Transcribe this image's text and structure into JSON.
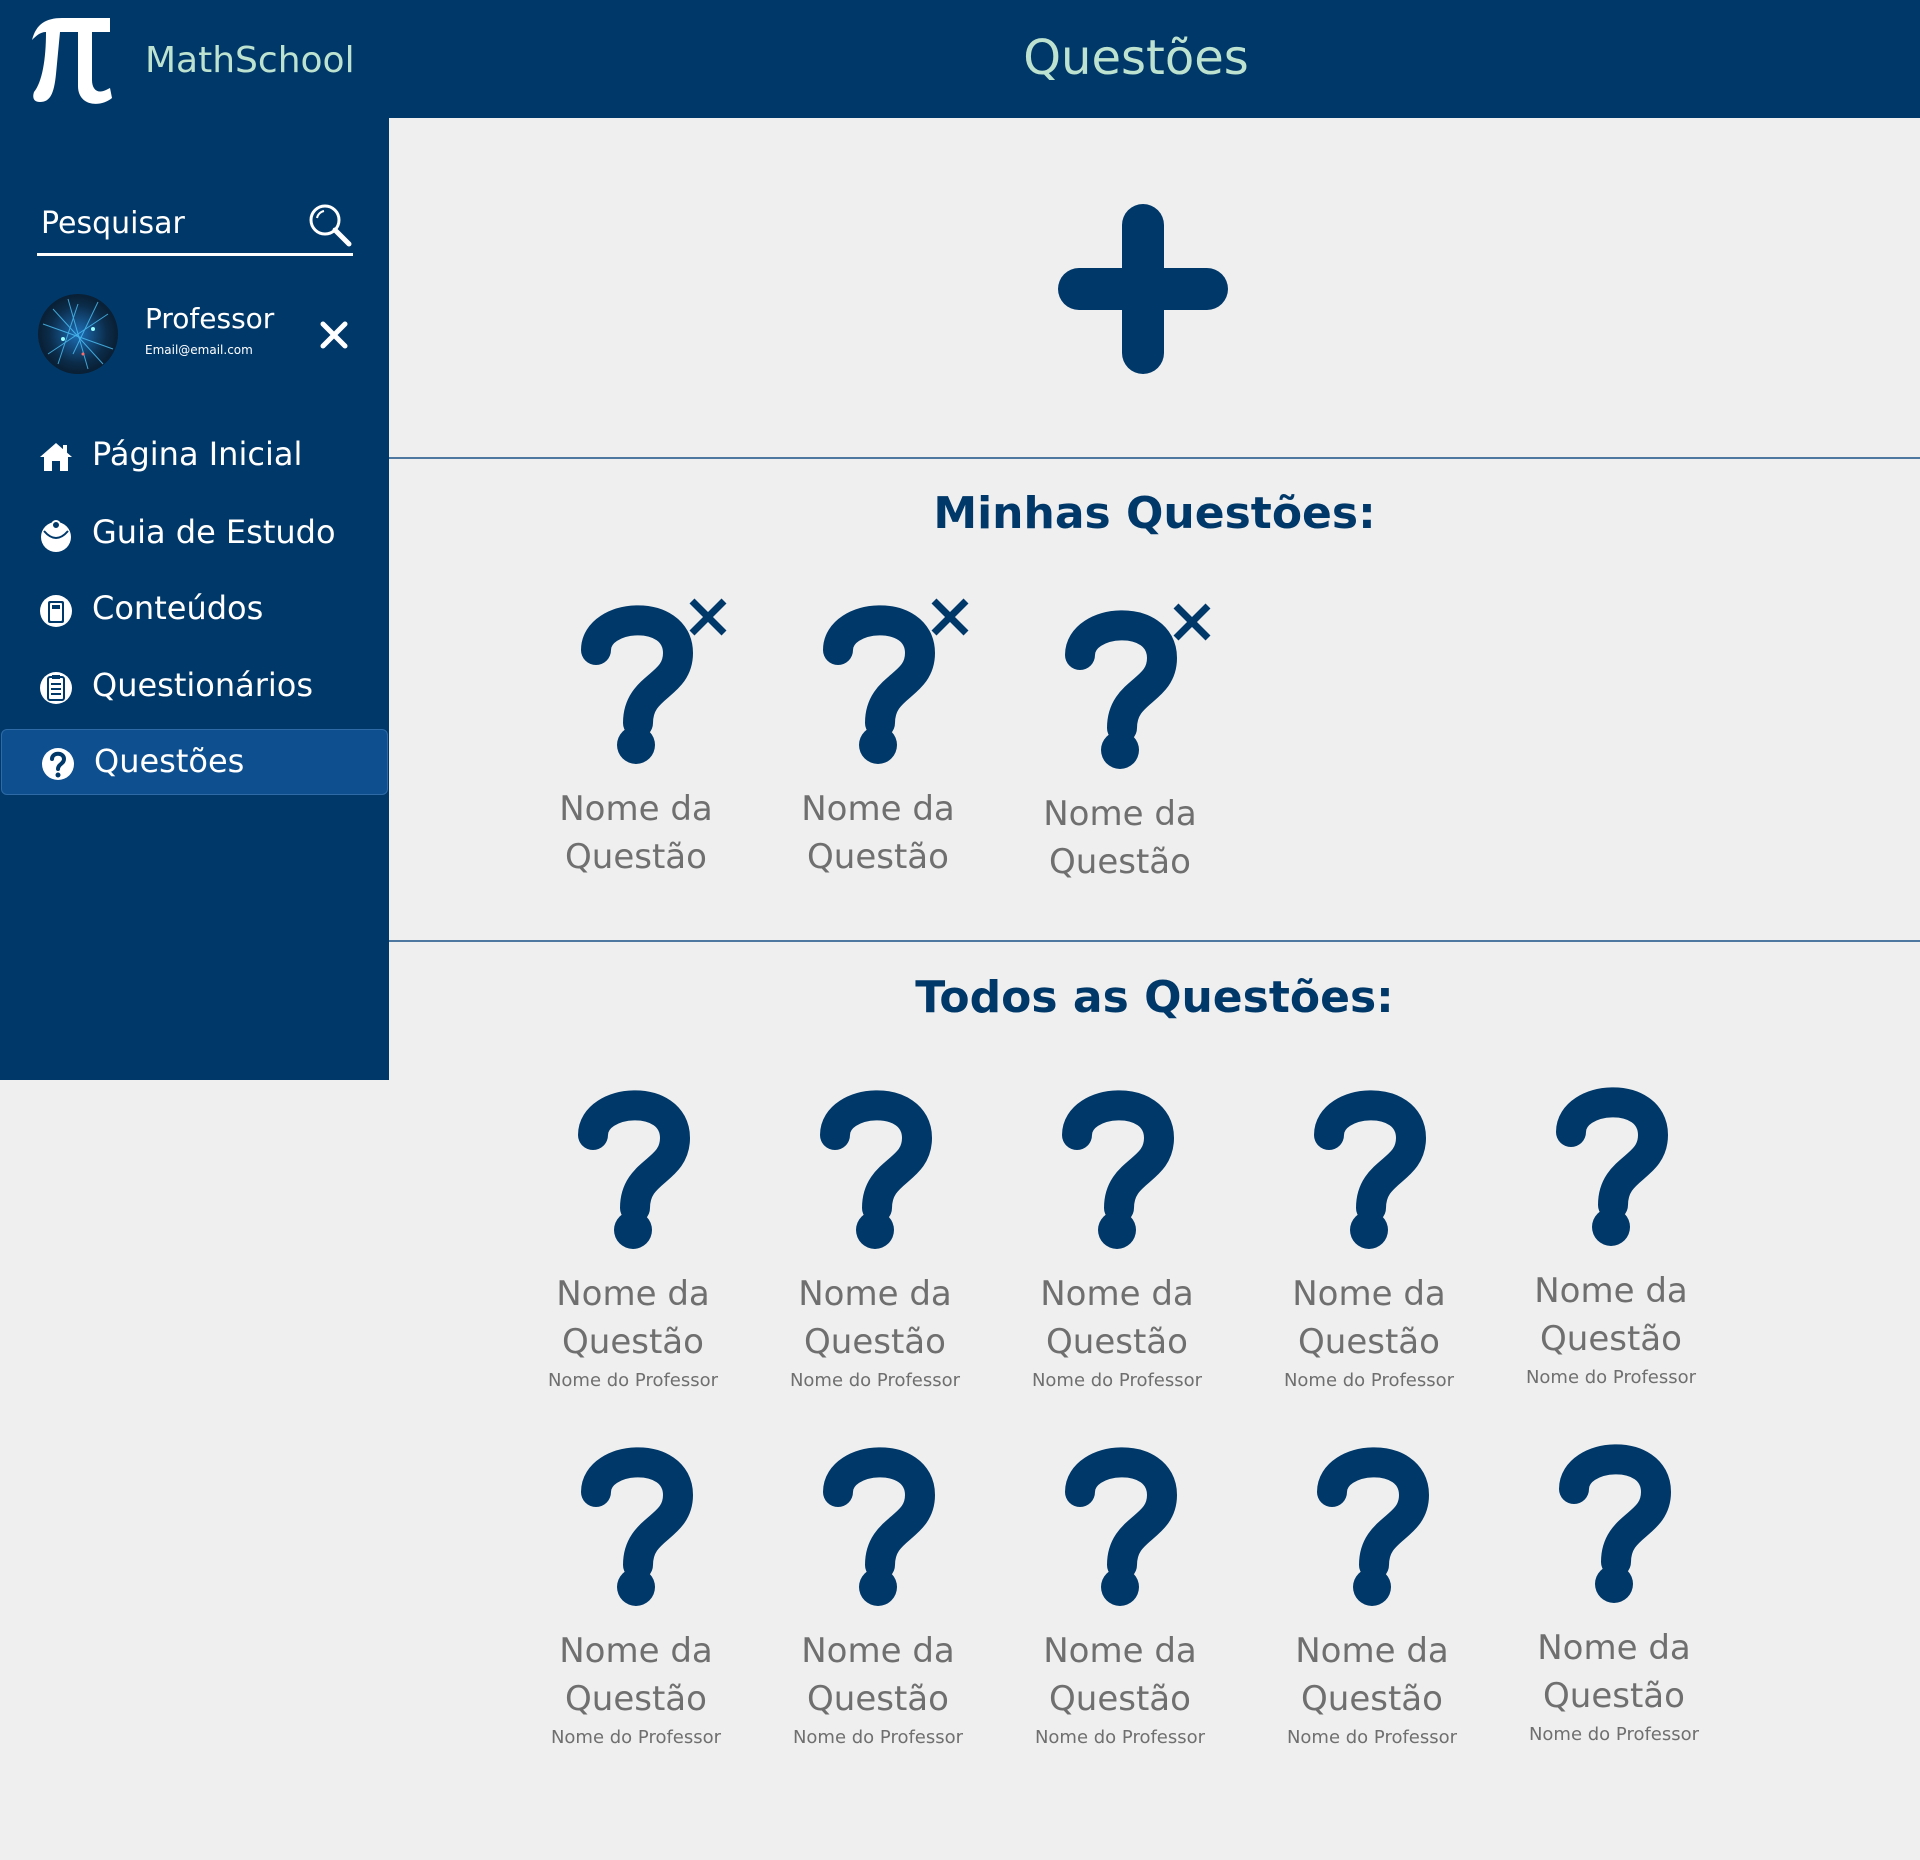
{
  "header": {
    "brand": "MathSchool",
    "title": "Questões"
  },
  "sidebar": {
    "search_placeholder": "Pesquisar",
    "profile": {
      "name": "Professor",
      "email": "Email@email.com"
    },
    "items": [
      {
        "label": "Página Inicial",
        "icon": "home-icon"
      },
      {
        "label": "Guia de Estudo",
        "icon": "compass-icon"
      },
      {
        "label": "Conteúdos",
        "icon": "book-icon"
      },
      {
        "label": "Questionários",
        "icon": "clipboard-icon"
      },
      {
        "label": "Questões",
        "icon": "question-circle-icon",
        "active": true
      }
    ]
  },
  "my_questions": {
    "title": "Minhas Questões:",
    "items": [
      {
        "name": "Nome da Questão"
      },
      {
        "name": "Nome da Questão"
      },
      {
        "name": "Nome da Questão"
      }
    ]
  },
  "all_questions": {
    "title": "Todos as Questões:",
    "items": [
      {
        "name": "Nome da Questão",
        "professor": "Nome do Professor"
      },
      {
        "name": "Nome da Questão",
        "professor": "Nome do Professor"
      },
      {
        "name": "Nome da Questão",
        "professor": "Nome do Professor"
      },
      {
        "name": "Nome da Questão",
        "professor": "Nome do Professor"
      },
      {
        "name": "Nome da Questão",
        "professor": "Nome do Professor"
      },
      {
        "name": "Nome da Questão",
        "professor": "Nome do Professor"
      },
      {
        "name": "Nome da Questão",
        "professor": "Nome do Professor"
      },
      {
        "name": "Nome da Questão",
        "professor": "Nome do Professor"
      },
      {
        "name": "Nome da Questão",
        "professor": "Nome do Professor"
      },
      {
        "name": "Nome da Questão",
        "professor": "Nome do Professor"
      }
    ]
  },
  "colors": {
    "primary": "#003869",
    "active": "#0e4f8f",
    "accent_text": "#bde3d0",
    "background": "#efefef",
    "muted_text": "#6f6f6f"
  }
}
